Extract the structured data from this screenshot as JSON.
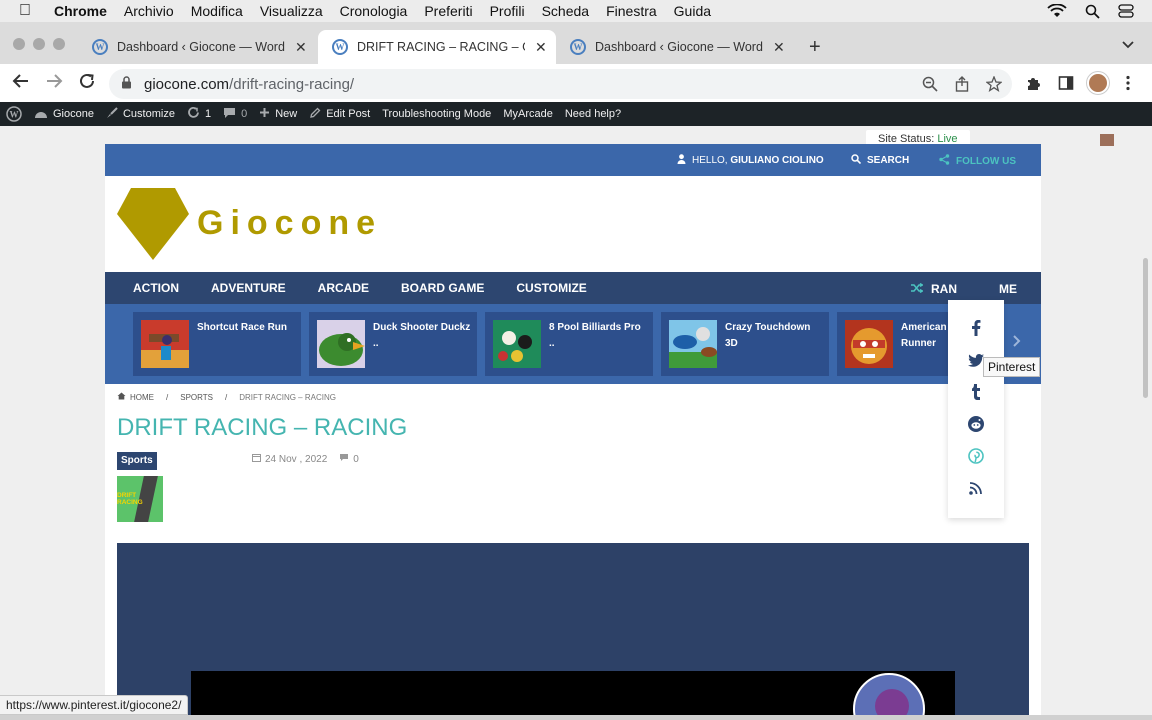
{
  "menubar": {
    "app": "Chrome",
    "items": [
      "Archivio",
      "Modifica",
      "Visualizza",
      "Cronologia",
      "Preferiti",
      "Profili",
      "Scheda",
      "Finestra",
      "Guida"
    ]
  },
  "tabs": [
    {
      "title": "Dashboard ‹ Giocone — WordPress"
    },
    {
      "title": "DRIFT RACING – RACING – Giocone"
    },
    {
      "title": "Dashboard ‹ Giocone — WordPress"
    }
  ],
  "address": {
    "host": "giocone.com",
    "path": "/drift-racing-racing/"
  },
  "adminbar": {
    "site": "Giocone",
    "customize": "Customize",
    "updates": "1",
    "comments": "0",
    "new": "New",
    "edit": "Edit Post",
    "troubleshoot": "Troubleshooting Mode",
    "myarcade": "MyArcade",
    "help": "Need help?"
  },
  "site_status": {
    "label": "Site Status:",
    "value": "Live"
  },
  "topbar": {
    "hello": "HELLO,",
    "user": "GIULIANO CIOLINO",
    "search": "SEARCH",
    "follow": "FOLLOW US"
  },
  "brand": {
    "name": "Giocone",
    "color": "#b09a00"
  },
  "categories": [
    "ACTION",
    "ADVENTURE",
    "ARCADE",
    "BOARD GAME",
    "CUSTOMIZE"
  ],
  "random_label": "RAN",
  "random_tail": "ME",
  "carousel": [
    {
      "name": "Shortcut Race Run"
    },
    {
      "name": "Duck Shooter Duckz .."
    },
    {
      "name": "8 Pool Billiards Pro .."
    },
    {
      "name": "Crazy Touchdown 3D"
    },
    {
      "name": "American Runner"
    }
  ],
  "breadcrumb": {
    "home": "HOME",
    "section": "SPORTS",
    "current": "DRIFT RACING – RACING"
  },
  "post": {
    "title": "DRIFT RACING – RACING",
    "category": "Sports",
    "date": "24 Nov , 2022",
    "comments": "0",
    "thumb_label": "DRIFT RACING"
  },
  "social_tooltip": "Pinterest",
  "status_url": "https://www.pinterest.it/giocone2/",
  "colors": {
    "accent": "#3b67aa",
    "nav": "#2d4670",
    "title": "#45b5b0",
    "follow": "#4cc3c0"
  }
}
